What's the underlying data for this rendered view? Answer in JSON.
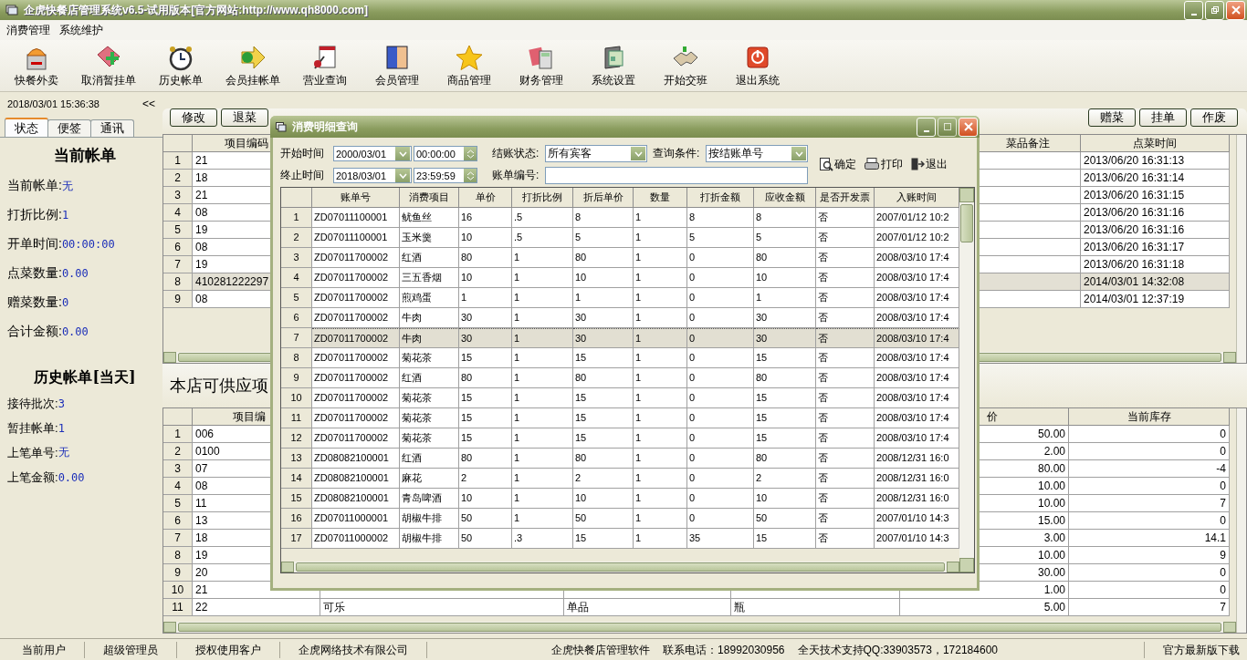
{
  "window": {
    "title": "企虎快餐店管理系统v6.5-试用版本[官方网站:http://www.qh8000.com]"
  },
  "menu": [
    "消费管理",
    "系统维护"
  ],
  "toolbar": [
    "快餐外卖",
    "取消暂挂单",
    "历史帐单",
    "会员挂帐单",
    "营业查询",
    "会员管理",
    "商品管理",
    "财务管理",
    "系统设置",
    "开始交班",
    "退出系统"
  ],
  "left_panel": {
    "datetime": "2018/03/01 15:36:38",
    "collapse_button": "<<",
    "tabs": [
      {
        "label": "状态",
        "selected": true
      },
      {
        "label": "便签",
        "selected": false
      },
      {
        "label": "通讯",
        "selected": false
      }
    ],
    "current_bill": {
      "heading": "当前帐单",
      "fields": [
        {
          "label": "当前帐单:",
          "value": "无"
        },
        {
          "label": "打折比例:",
          "value": "1"
        },
        {
          "label": "开单时间:",
          "value": "00:00:00"
        },
        {
          "label": "点菜数量:",
          "value": "0.00"
        },
        {
          "label": "赠菜数量:",
          "value": "0"
        },
        {
          "label": "合计金额:",
          "value": "0.00"
        }
      ]
    },
    "history": {
      "heading": "历史帐单[当天]",
      "fields": [
        {
          "label": "接待批次:",
          "value": "3"
        },
        {
          "label": "暂挂帐单:",
          "value": "1"
        },
        {
          "label": "上笔单号:",
          "value": "无"
        },
        {
          "label": "上笔金额:",
          "value": "0.00"
        }
      ]
    }
  },
  "order_panel": {
    "left_buttons": [
      "修改",
      "退菜"
    ],
    "right_buttons": [
      "赠菜",
      "挂单",
      "作废"
    ],
    "table": {
      "columns": [
        "项目编码",
        "菜品备注",
        "点菜时间"
      ],
      "rows": [
        {
          "number": "1",
          "code": "21",
          "time": "2013/06/20 16:31:13",
          "selected": false
        },
        {
          "number": "2",
          "code": "18",
          "time": "2013/06/20 16:31:14",
          "selected": false
        },
        {
          "number": "3",
          "code": "21",
          "time": "2013/06/20 16:31:15",
          "selected": false
        },
        {
          "number": "4",
          "code": "08",
          "time": "2013/06/20 16:31:16",
          "selected": false
        },
        {
          "number": "5",
          "code": "19",
          "time": "2013/06/20 16:31:16",
          "selected": false
        },
        {
          "number": "6",
          "code": "08",
          "time": "2013/06/20 16:31:17",
          "selected": false
        },
        {
          "number": "7",
          "code": "19",
          "time": "2013/06/20 16:31:18",
          "selected": false
        },
        {
          "number": "8",
          "code": "410281222297",
          "time": "2014/03/01 14:32:08",
          "selected": true
        },
        {
          "number": "9",
          "code": "08",
          "time": "2014/03/01 12:37:19",
          "selected": false
        }
      ]
    }
  },
  "menu_panel": {
    "title": "本店可供应项",
    "table": {
      "columns": [
        "项目编",
        "价",
        "当前库存"
      ],
      "rows": [
        {
          "number": "1",
          "code": "006",
          "price": "50.00",
          "stock": "0"
        },
        {
          "number": "2",
          "code": "0100",
          "price": "2.00",
          "stock": "0"
        },
        {
          "number": "3",
          "code": "07",
          "price": "80.00",
          "stock": "-4"
        },
        {
          "number": "4",
          "code": "08",
          "price": "10.00",
          "stock": "0"
        },
        {
          "number": "5",
          "code": "11",
          "price": "10.00",
          "stock": "7"
        },
        {
          "number": "6",
          "code": "13",
          "price": "15.00",
          "stock": "0"
        },
        {
          "number": "7",
          "code": "18",
          "price": "3.00",
          "stock": "14.1"
        },
        {
          "number": "8",
          "code": "19",
          "price": "10.00",
          "stock": "9"
        },
        {
          "number": "9",
          "code": "20",
          "price": "30.00",
          "stock": "0"
        },
        {
          "number": "10",
          "code": "21",
          "price": "1.00",
          "stock": "0"
        },
        {
          "number": "11",
          "code": "22",
          "name": "可乐",
          "type": "单品",
          "unit": "瓶",
          "price": "5.00",
          "stock": "7"
        }
      ]
    }
  },
  "dialog": {
    "title": "消费明细查询",
    "start_label": "开始时间",
    "start_date": "2000/03/01",
    "start_time": "00:00:00",
    "end_label": "终止时间",
    "end_date": "2018/03/01",
    "end_time": "23:59:59",
    "status_label": "结账状态:",
    "status_value": "所有宾客",
    "condition_label": "查询条件:",
    "condition_value": "按结账单号",
    "bill_label": "账单编号:",
    "buttons": [
      "确定",
      "打印",
      "退出"
    ],
    "table": {
      "columns": [
        "账单号",
        "消费项目",
        "单价",
        "打折比例",
        "折后单价",
        "数量",
        "打折金额",
        "应收金额",
        "是否开发票",
        "入账时间"
      ],
      "rows": [
        {
          "number": "1",
          "selected": false,
          "cells": [
            "ZD07011100001",
            "鱿鱼丝",
            "16",
            ".5",
            "8",
            "1",
            "8",
            "8",
            "否",
            "2007/01/12 10:2"
          ]
        },
        {
          "number": "2",
          "selected": false,
          "cells": [
            "ZD07011100001",
            "玉米羹",
            "10",
            ".5",
            "5",
            "1",
            "5",
            "5",
            "否",
            "2007/01/12 10:2"
          ]
        },
        {
          "number": "3",
          "selected": false,
          "cells": [
            "ZD07011700002",
            "红酒",
            "80",
            "1",
            "80",
            "1",
            "0",
            "80",
            "否",
            "2008/03/10 17:4"
          ]
        },
        {
          "number": "4",
          "selected": false,
          "cells": [
            "ZD07011700002",
            "三五香烟",
            "10",
            "1",
            "10",
            "1",
            "0",
            "10",
            "否",
            "2008/03/10 17:4"
          ]
        },
        {
          "number": "5",
          "selected": false,
          "cells": [
            "ZD07011700002",
            "煎鸡蛋",
            "1",
            "1",
            "1",
            "1",
            "0",
            "1",
            "否",
            "2008/03/10 17:4"
          ]
        },
        {
          "number": "6",
          "selected": false,
          "cells": [
            "ZD07011700002",
            "牛肉",
            "30",
            "1",
            "30",
            "1",
            "0",
            "30",
            "否",
            "2008/03/10 17:4"
          ]
        },
        {
          "number": "7",
          "selected": true,
          "cells": [
            "ZD07011700002",
            "牛肉",
            "30",
            "1",
            "30",
            "1",
            "0",
            "30",
            "否",
            "2008/03/10 17:4"
          ]
        },
        {
          "number": "8",
          "selected": false,
          "cells": [
            "ZD07011700002",
            "菊花茶",
            "15",
            "1",
            "15",
            "1",
            "0",
            "15",
            "否",
            "2008/03/10 17:4"
          ]
        },
        {
          "number": "9",
          "selected": false,
          "cells": [
            "ZD07011700002",
            "红酒",
            "80",
            "1",
            "80",
            "1",
            "0",
            "80",
            "否",
            "2008/03/10 17:4"
          ]
        },
        {
          "number": "10",
          "selected": false,
          "cells": [
            "ZD07011700002",
            "菊花茶",
            "15",
            "1",
            "15",
            "1",
            "0",
            "15",
            "否",
            "2008/03/10 17:4"
          ]
        },
        {
          "number": "11",
          "selected": false,
          "cells": [
            "ZD07011700002",
            "菊花茶",
            "15",
            "1",
            "15",
            "1",
            "0",
            "15",
            "否",
            "2008/03/10 17:4"
          ]
        },
        {
          "number": "12",
          "selected": false,
          "cells": [
            "ZD07011700002",
            "菊花茶",
            "15",
            "1",
            "15",
            "1",
            "0",
            "15",
            "否",
            "2008/03/10 17:4"
          ]
        },
        {
          "number": "13",
          "selected": false,
          "cells": [
            "ZD08082100001",
            "红酒",
            "80",
            "1",
            "80",
            "1",
            "0",
            "80",
            "否",
            "2008/12/31 16:0"
          ]
        },
        {
          "number": "14",
          "selected": false,
          "cells": [
            "ZD08082100001",
            "麻花",
            "2",
            "1",
            "2",
            "1",
            "0",
            "2",
            "否",
            "2008/12/31 16:0"
          ]
        },
        {
          "number": "15",
          "selected": false,
          "cells": [
            "ZD08082100001",
            "青岛啤酒",
            "10",
            "1",
            "10",
            "1",
            "0",
            "10",
            "否",
            "2008/12/31 16:0"
          ]
        },
        {
          "number": "16",
          "selected": false,
          "cells": [
            "ZD07011000001",
            "胡椒牛排",
            "50",
            "1",
            "50",
            "1",
            "0",
            "50",
            "否",
            "2007/01/10 14:3"
          ]
        },
        {
          "number": "17",
          "selected": false,
          "cells": [
            "ZD07011000002",
            "胡椒牛排",
            "50",
            ".3",
            "15",
            "1",
            "35",
            "15",
            "否",
            "2007/01/10 14:3"
          ]
        }
      ]
    }
  },
  "status_bar": {
    "left": [
      "当前用户",
      "超级管理员",
      "授权使用客户",
      "企虎网络技术有限公司"
    ],
    "center": [
      "企虎快餐店管理软件",
      "联系电话：18992030956",
      "全天技术支持QQ:33903573，172184600"
    ],
    "right": "官方最新版下载"
  }
}
